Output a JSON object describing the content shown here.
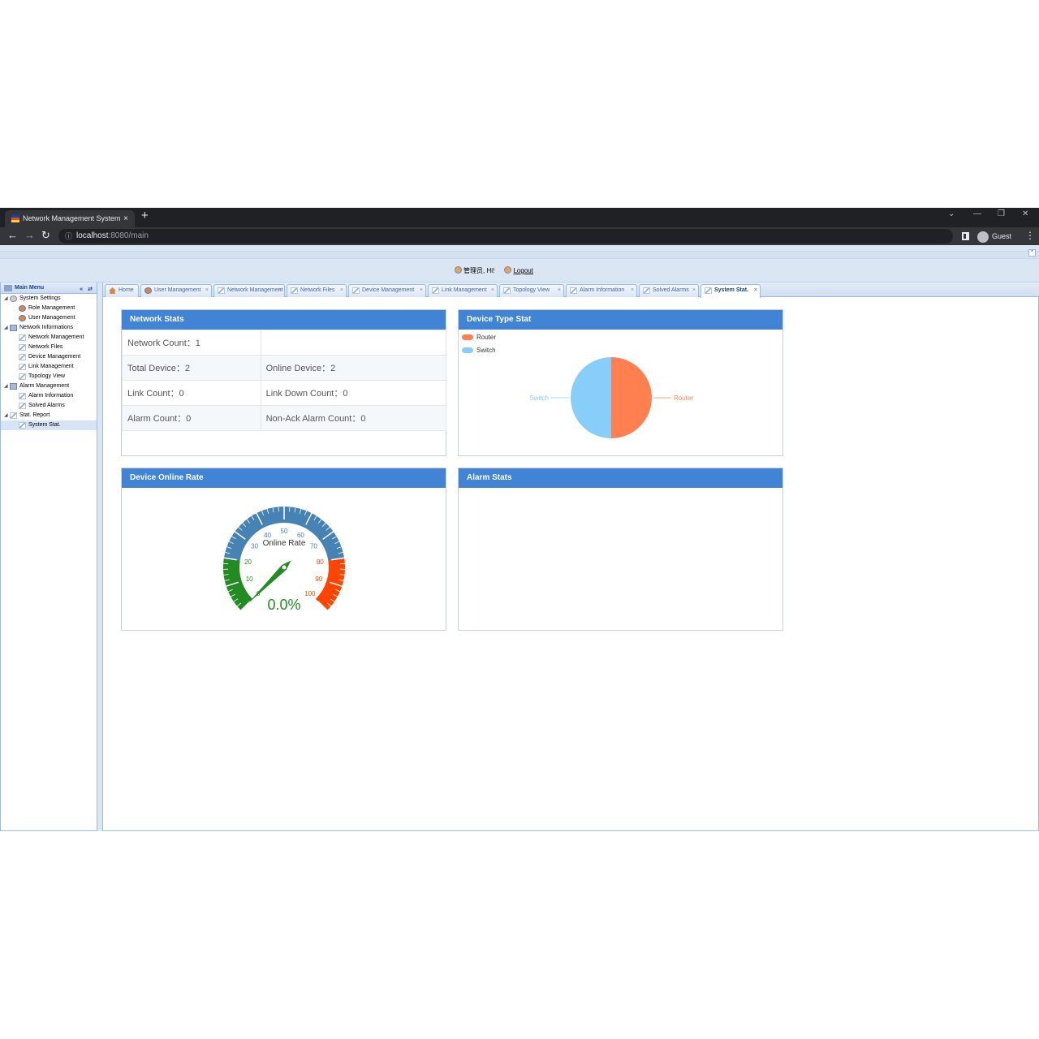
{
  "browser": {
    "tab_title": "Network Management System",
    "tab_close": "×",
    "new_tab": "+",
    "address_host": "localhost",
    "address_path": ":8080/main",
    "profile": "Guest",
    "controls": {
      "minimize": "—",
      "restore": "❐",
      "close": "✕",
      "dropdown": "⌄"
    }
  },
  "header": {
    "greeting": "管理员, Hi!",
    "logout": "Logout"
  },
  "sidebar": {
    "title": "Main Menu",
    "buttons": "« ⇄",
    "tree": [
      {
        "label": "System Settings",
        "level": 0,
        "icon": "gear-icon"
      },
      {
        "label": "Role Management",
        "level": 1,
        "icon": "users-icon"
      },
      {
        "label": "User Management",
        "level": 1,
        "icon": "user-icon"
      },
      {
        "label": "Network Informations",
        "level": 0,
        "icon": "network-icon"
      },
      {
        "label": "Network Management",
        "level": 1,
        "icon": "tag-icon"
      },
      {
        "label": "Network Files",
        "level": 1,
        "icon": "tag-icon"
      },
      {
        "label": "Device Management",
        "level": 1,
        "icon": "tag-icon"
      },
      {
        "label": "Link Management",
        "level": 1,
        "icon": "tag-icon"
      },
      {
        "label": "Topology View",
        "level": 1,
        "icon": "tag-icon"
      },
      {
        "label": "Alarm Management",
        "level": 0,
        "icon": "network-icon"
      },
      {
        "label": "Alarm Information",
        "level": 1,
        "icon": "tag-icon"
      },
      {
        "label": "Solved Alarms",
        "level": 1,
        "icon": "tag-icon"
      },
      {
        "label": "Stat. Report",
        "level": 0,
        "icon": "tag-icon"
      },
      {
        "label": "System Stat.",
        "level": 1,
        "icon": "tag-icon",
        "selected": true
      }
    ]
  },
  "tabs": [
    {
      "label": "Home",
      "icon": "home-icon",
      "closable": false
    },
    {
      "label": "User Management",
      "icon": "user-icon",
      "closable": true
    },
    {
      "label": "Network Management",
      "icon": "tag-icon",
      "closable": true
    },
    {
      "label": "Network Files",
      "icon": "tag-icon",
      "closable": true
    },
    {
      "label": "Device Management",
      "icon": "tag-icon",
      "closable": true
    },
    {
      "label": "Link Management",
      "icon": "tag-icon",
      "closable": true
    },
    {
      "label": "Topology View",
      "icon": "tag-icon",
      "closable": true
    },
    {
      "label": "Alarm Information",
      "icon": "tag-icon",
      "closable": true
    },
    {
      "label": "Solved Alarms",
      "icon": "tag-icon",
      "closable": true
    },
    {
      "label": "System Stat.",
      "icon": "tag-icon",
      "closable": true,
      "active": true
    }
  ],
  "network_stats": {
    "title": "Network Stats",
    "rows": [
      [
        "Network Count：1",
        ""
      ],
      [
        "Total Device：2",
        "Online Device：2"
      ],
      [
        "Link Count：0",
        "Link Down Count：0"
      ],
      [
        "Alarm Count：0",
        "Non-Ack Alarm Count：0"
      ]
    ]
  },
  "device_type": {
    "title": "Device Type Stat",
    "legend": [
      {
        "name": "Router",
        "color": "#ff7f50"
      },
      {
        "name": "Switch",
        "color": "#87cefa"
      }
    ]
  },
  "online_rate": {
    "title": "Device Online Rate",
    "gauge_label": "Online Rate",
    "value_text": "0.0%"
  },
  "alarm_stats": {
    "title": "Alarm Stats"
  },
  "chart_data": [
    {
      "type": "pie",
      "title": "Device Type Stat",
      "categories": [
        "Router",
        "Switch"
      ],
      "values": [
        1,
        1
      ],
      "colors": [
        "#ff7f50",
        "#87cefa"
      ],
      "legend": "top-left"
    },
    {
      "type": "gauge",
      "title": "Device Online Rate",
      "label": "Online Rate",
      "value": 0,
      "range": [
        0,
        100
      ],
      "ticks": [
        0,
        10,
        20,
        30,
        40,
        50,
        60,
        70,
        80,
        90,
        100
      ],
      "bands": [
        {
          "to": 20,
          "color": "#228b22"
        },
        {
          "to": 80,
          "color": "#4682b4"
        },
        {
          "to": 100,
          "color": "#ff4500"
        }
      ]
    }
  ]
}
